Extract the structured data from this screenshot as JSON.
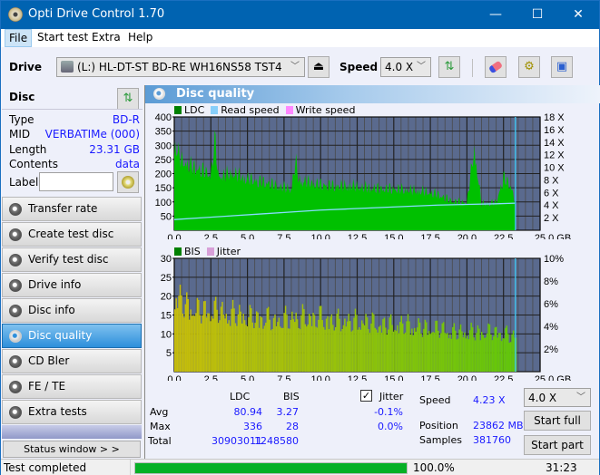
{
  "window": {
    "title": "Opti Drive Control 1.70",
    "controls": {
      "minimize": "—",
      "maximize": "☐",
      "close": "✕"
    }
  },
  "menu": [
    {
      "label": "File"
    },
    {
      "label": "Start test"
    },
    {
      "label": "Extra"
    },
    {
      "label": "Help"
    }
  ],
  "toolbar": {
    "drive_label": "Drive",
    "drive_value": "(L:)  HL-DT-ST BD-RE  WH16NS58 TST4",
    "speed_label": "Speed",
    "speed_value": "4.0 X",
    "icons": [
      "eject-icon",
      "refresh-icon",
      "erase-icon",
      "settings-icon",
      "save-icon"
    ]
  },
  "disc": {
    "title": "Disc",
    "fields": [
      {
        "k": "Type",
        "v": "BD-R"
      },
      {
        "k": "MID",
        "v": "VERBATIMe (000)"
      },
      {
        "k": "Length",
        "v": "23.31 GB"
      },
      {
        "k": "Contents",
        "v": "data"
      }
    ],
    "label_key": "Label",
    "label_value": ""
  },
  "nav": [
    {
      "label": "Transfer rate"
    },
    {
      "label": "Create test disc"
    },
    {
      "label": "Verify test disc"
    },
    {
      "label": "Drive info"
    },
    {
      "label": "Disc info"
    },
    {
      "label": "Disc quality",
      "selected": true
    },
    {
      "label": "CD Bler"
    },
    {
      "label": "FE / TE"
    },
    {
      "label": "Extra tests"
    }
  ],
  "status_window_label": "Status window > >",
  "panel": {
    "title": "Disc quality"
  },
  "chart_data": [
    {
      "type": "area",
      "title": "",
      "legend": [
        {
          "name": "LDC",
          "color": "#008000"
        },
        {
          "name": "Read speed",
          "color": "#87cefa"
        },
        {
          "name": "Write speed",
          "color": "#ff88ff"
        }
      ],
      "xlabel": "GB",
      "x_ticks": [
        "0.0",
        "2.5",
        "5.0",
        "7.5",
        "10.0",
        "12.5",
        "15.0",
        "17.5",
        "20.0",
        "22.5",
        "25.0 GB"
      ],
      "xlim": [
        0,
        25
      ],
      "y_ticks": [
        "400",
        "350",
        "300",
        "250",
        "200",
        "150",
        "100",
        "50"
      ],
      "ylim": [
        0,
        400
      ],
      "y2_ticks": [
        "18 X",
        "16 X",
        "14 X",
        "12 X",
        "10 X",
        "8 X",
        "6 X",
        "4 X",
        "2 X"
      ],
      "y2lim": [
        0,
        18
      ],
      "series": [
        {
          "name": "LDC",
          "x": [
            0,
            0.5,
            1,
            1.5,
            2,
            2.5,
            2.8,
            3,
            3.5,
            4,
            4.5,
            5,
            5.5,
            6,
            6.5,
            7,
            7.5,
            8,
            8.3,
            8.5,
            9,
            9.5,
            10,
            11,
            12,
            13,
            14,
            15,
            16,
            17,
            18,
            19,
            20,
            20.5,
            21,
            22,
            22.5,
            23,
            23.3
          ],
          "values": [
            310,
            250,
            235,
            225,
            215,
            200,
            330,
            195,
            200,
            205,
            195,
            185,
            180,
            175,
            170,
            160,
            155,
            150,
            250,
            180,
            175,
            170,
            165,
            160,
            160,
            155,
            150,
            150,
            145,
            140,
            130,
            105,
            100,
            290,
            95,
            100,
            190,
            160,
            105
          ]
        },
        {
          "name": "Read speed",
          "x": [
            0,
            2,
            4,
            6,
            8,
            10,
            12,
            14,
            16,
            18,
            20,
            22,
            23.3
          ],
          "values": [
            1.7,
            2.0,
            2.3,
            2.6,
            2.9,
            3.2,
            3.4,
            3.6,
            3.8,
            4.0,
            4.1,
            4.2,
            4.3
          ]
        }
      ],
      "end_marker_gb": 23.31
    },
    {
      "type": "bar",
      "title": "",
      "legend": [
        {
          "name": "BIS",
          "color": "#008000"
        },
        {
          "name": "Jitter",
          "color": "#d8a0d8"
        }
      ],
      "xlabel": "GB",
      "x_ticks": [
        "0.0",
        "2.5",
        "5.0",
        "7.5",
        "10.0",
        "12.5",
        "15.0",
        "17.5",
        "20.0",
        "22.5",
        "25.0 GB"
      ],
      "xlim": [
        0,
        25
      ],
      "y_ticks": [
        "30",
        "25",
        "20",
        "15",
        "10",
        "5"
      ],
      "ylim": [
        0,
        30
      ],
      "y2_ticks": [
        "10%",
        "8%",
        "6%",
        "4%",
        "2%"
      ],
      "y2lim": [
        0,
        10
      ],
      "series": [
        {
          "name": "BIS",
          "x": [
            0,
            0.5,
            1,
            1.5,
            2,
            2.5,
            3,
            3.5,
            4,
            4.5,
            5,
            6,
            7,
            8,
            9,
            10,
            11,
            12,
            13,
            14,
            15,
            16,
            17,
            18,
            19,
            20,
            21,
            22,
            23,
            23.3
          ],
          "values": [
            22,
            19,
            18,
            17,
            17,
            17,
            17,
            16,
            16,
            16,
            15,
            15,
            14,
            15,
            15,
            15,
            14,
            14,
            14,
            13,
            13,
            13,
            12,
            12,
            11,
            11,
            11,
            11,
            10,
            10
          ]
        }
      ],
      "end_marker_gb": 23.31
    }
  ],
  "stats": {
    "col_ldc": "LDC",
    "col_bis": "BIS",
    "rows": [
      {
        "k": "Avg",
        "ldc": "80.94",
        "bis": "3.27",
        "jitter": "-0.1%"
      },
      {
        "k": "Max",
        "ldc": "336",
        "bis": "28",
        "jitter": "0.0%"
      },
      {
        "k": "Total",
        "ldc": "30903011",
        "bis": "1248580"
      }
    ],
    "jitter_label": "Jitter",
    "jitter_checked": true,
    "speed_label": "Speed",
    "speed_value": "4.23 X",
    "position_label": "Position",
    "position_value": "23862 MB",
    "samples_label": "Samples",
    "samples_value": "381760",
    "speed_select": "4.0 X",
    "start_full": "Start full",
    "start_part": "Start part"
  },
  "statusbar": {
    "text": "Test completed",
    "progress": 100,
    "progress_text": "100.0%",
    "time": "31:23"
  }
}
